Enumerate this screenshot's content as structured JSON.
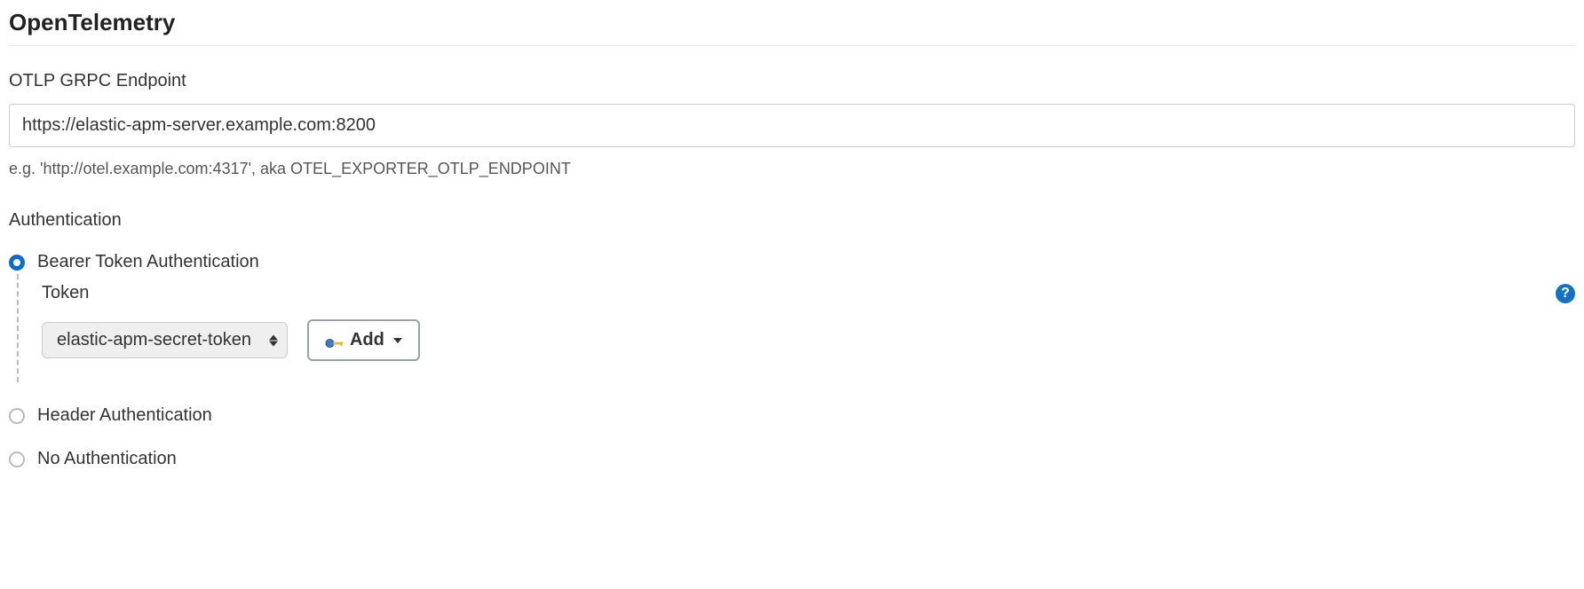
{
  "section": {
    "title": "OpenTelemetry"
  },
  "endpoint": {
    "label": "OTLP GRPC Endpoint",
    "value": "https://elastic-apm-server.example.com:8200",
    "help": "e.g. 'http://otel.example.com:4317', aka OTEL_EXPORTER_OTLP_ENDPOINT"
  },
  "auth": {
    "heading": "Authentication",
    "options": {
      "bearer": "Bearer Token Authentication",
      "header": "Header Authentication",
      "none": "No Authentication"
    },
    "token": {
      "label": "Token",
      "selected": "elastic-apm-secret-token",
      "add_label": "Add"
    }
  }
}
